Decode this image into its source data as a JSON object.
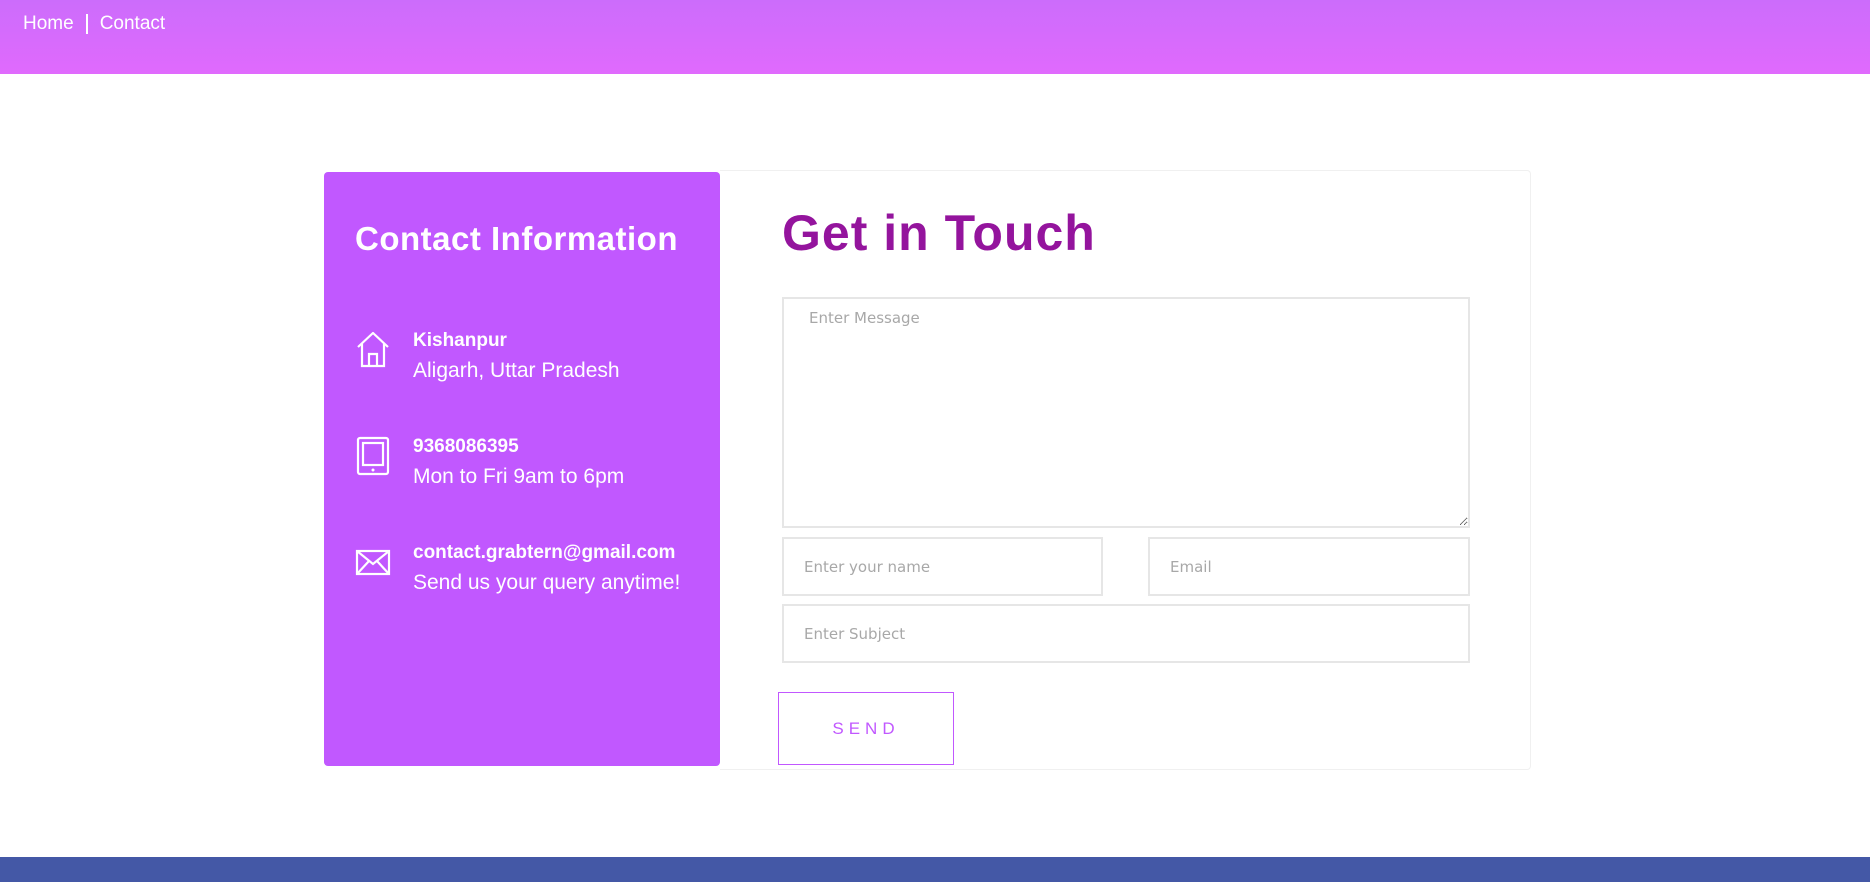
{
  "nav": {
    "home_label": "Home",
    "contact_label": "Contact"
  },
  "info": {
    "title": "Contact Information",
    "address_primary": "Kishanpur",
    "address_secondary": "Aligarh, Uttar Pradesh",
    "phone_primary": "9368086395",
    "phone_secondary": "Mon to Fri 9am to 6pm",
    "email_primary": "contact.grabtern@gmail.com",
    "email_secondary": "Send us your query anytime!"
  },
  "form": {
    "title": "Get in Touch",
    "message_placeholder": "Enter Message",
    "name_placeholder": "Enter your name",
    "email_placeholder": "Email",
    "subject_placeholder": "Enter Subject",
    "send_label": "SEND"
  },
  "icons": {
    "address": "home-icon",
    "phone": "tablet-icon",
    "email": "envelope-icon"
  },
  "colors": {
    "topbar_gradient_start": "#cc6cfb",
    "topbar_gradient_end": "#e06afd",
    "panel": "#c158ff",
    "title": "#94149d",
    "footer": "#4458a6"
  }
}
